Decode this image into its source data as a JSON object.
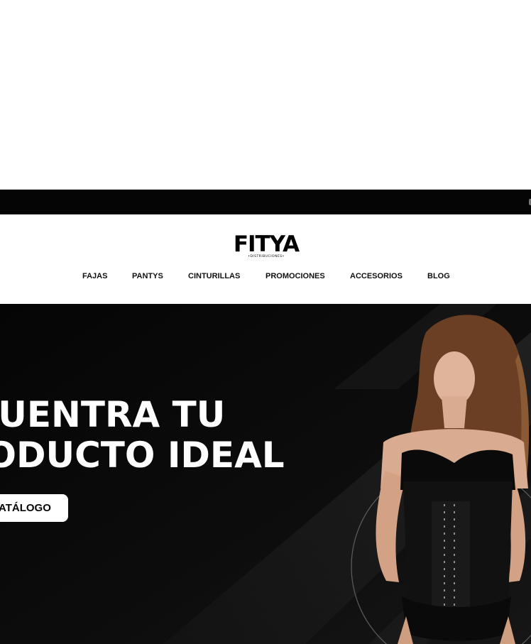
{
  "announcement_bar": {
    "text": ""
  },
  "header": {
    "logo": {
      "wordmark": "FITYA",
      "tagline": "•DISTRIBUCIONES•"
    },
    "nav": [
      {
        "label": "FAJAS"
      },
      {
        "label": "PANTYS"
      },
      {
        "label": "CINTURILLAS"
      },
      {
        "label": "PROMOCIONES"
      },
      {
        "label": "ACCESORIOS"
      },
      {
        "label": "BLOG"
      }
    ]
  },
  "hero": {
    "title_line1": "ICUENTRA TU",
    "title_line2": "RODUCTO IDEAL",
    "button_label": "ATÁLOGO"
  },
  "colors": {
    "hero_background": "#0b0b0b",
    "announcement_bar": "#050505",
    "text_primary": "#111111",
    "button_background": "#ffffff"
  }
}
